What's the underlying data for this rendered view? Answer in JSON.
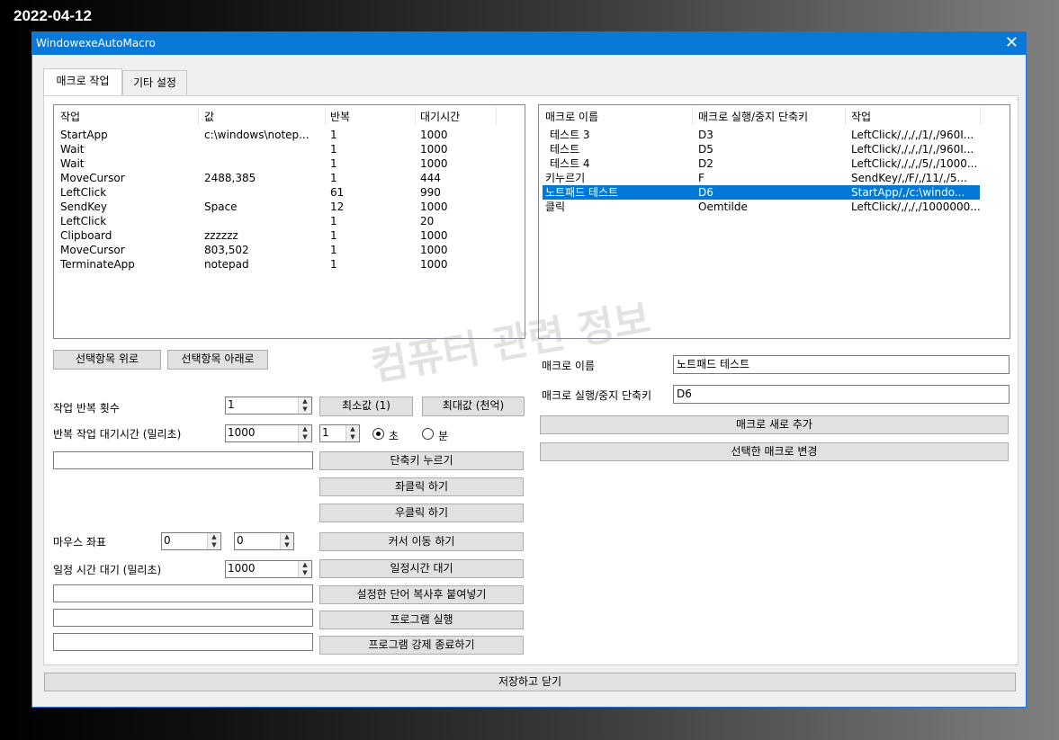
{
  "date_overlay": "2022-04-12",
  "window": {
    "title": "WindowexeAutoMacro",
    "close_glyph": "✕"
  },
  "tabs": [
    {
      "label": "매크로 작업"
    },
    {
      "label": "기타 설정"
    }
  ],
  "action_list": {
    "columns": [
      "작업",
      "값",
      "반복",
      "대기시간"
    ],
    "rows": [
      [
        "StartApp",
        "c:\\windows\\notep...",
        "1",
        "1000"
      ],
      [
        "Wait",
        "",
        "1",
        "1000"
      ],
      [
        "Wait",
        "",
        "1",
        "1000"
      ],
      [
        "MoveCursor",
        "2488,385",
        "1",
        "444"
      ],
      [
        "LeftClick",
        "",
        "61",
        "990"
      ],
      [
        "SendKey",
        "Space",
        "12",
        "1000"
      ],
      [
        "LeftClick",
        "",
        "1",
        "20"
      ],
      [
        "Clipboard",
        "zzzzzz",
        "1",
        "1000"
      ],
      [
        "MoveCursor",
        "803,502",
        "1",
        "1000"
      ],
      [
        "TerminateApp",
        "notepad",
        "1",
        "1000"
      ]
    ]
  },
  "macro_list": {
    "columns": [
      "매크로 이름",
      "매크로 실행/중지 단축키",
      "작업"
    ],
    "rows": [
      [
        "테스트 3",
        "D3",
        "LeftClick/,/,/,/1/,/960I..."
      ],
      [
        "테스트",
        "D5",
        "LeftClick/,/,/,/1/,/960I..."
      ],
      [
        "테스트 4",
        "D2",
        "LeftClick/,/,/,/5/,/1000..."
      ],
      [
        "키누르기",
        "F",
        "SendKey/,/F/,/11/,/5..."
      ],
      [
        "노트패드 테스트",
        "D6",
        "StartApp/,/c:\\windo..."
      ],
      [
        "클릭",
        "Oemtilde",
        "LeftClick/,/,/,/1000000..."
      ]
    ],
    "selected_index": 4
  },
  "buttons": {
    "move_up": "선택항목 위로",
    "move_down": "선택항목 아래로",
    "min_value": "최소값 (1)",
    "max_value": "최대값 (천억)",
    "press_hotkey": "단축키 누르기",
    "left_click": "좌클릭 하기",
    "right_click": "우클릭 하기",
    "move_cursor": "커서 이동 하기",
    "wait": "일정시간 대기",
    "paste_text": "설정한 단어 복사후 붙여넣기",
    "run_program": "프로그램 실행",
    "kill_program": "프로그램 강제 종료하기",
    "add_macro": "매크로 새로 추가",
    "change_macro": "선택한 매크로 변경",
    "save_close": "저장하고 닫기"
  },
  "form": {
    "repeat_label": "작업 반복 횟수",
    "repeat_value": "1",
    "delay_label": "반복 작업 대기시간 (밀리초)",
    "delay_value": "1000",
    "delay_unit_value": "1",
    "radio_seconds": "초",
    "radio_minutes": "분",
    "selected_unit": "초",
    "hotkey_value": "",
    "mouse_label": "마우스 좌표",
    "mouse_x": "0",
    "mouse_y": "0",
    "wait_label": "일정 시간 대기 (밀리초)",
    "wait_value": "1000",
    "paste_value": "",
    "program_value": "",
    "kill_value": ""
  },
  "macro_form": {
    "name_label": "매크로 이름",
    "name_value": "노트패드 테스트",
    "hotkey_label": "매크로 실행/중지 단축키",
    "hotkey_value": "D6"
  },
  "watermark": "컴퓨터 관련 정보"
}
